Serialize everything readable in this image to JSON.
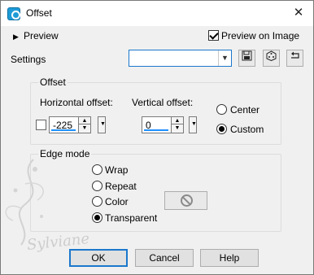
{
  "window": {
    "title": "Offset",
    "close_symbol": "✕"
  },
  "top": {
    "preview_label": "Preview",
    "preview_on_image_label": "Preview on Image",
    "preview_on_image_checked": true,
    "settings_label": "Settings",
    "settings_value": ""
  },
  "offset_group": {
    "title": "Offset",
    "horizontal_label": "Horizontal offset:",
    "horizontal_value": "-225",
    "vertical_label": "Vertical offset:",
    "vertical_value": "0",
    "center_label": "Center",
    "custom_label": "Custom",
    "selected": "custom"
  },
  "edge_group": {
    "title": "Edge mode",
    "wrap_label": "Wrap",
    "repeat_label": "Repeat",
    "color_label": "Color",
    "transparent_label": "Transparent",
    "selected": "transparent"
  },
  "buttons": {
    "ok": "OK",
    "cancel": "Cancel",
    "help": "Help"
  },
  "watermark_text": "Sylviane"
}
